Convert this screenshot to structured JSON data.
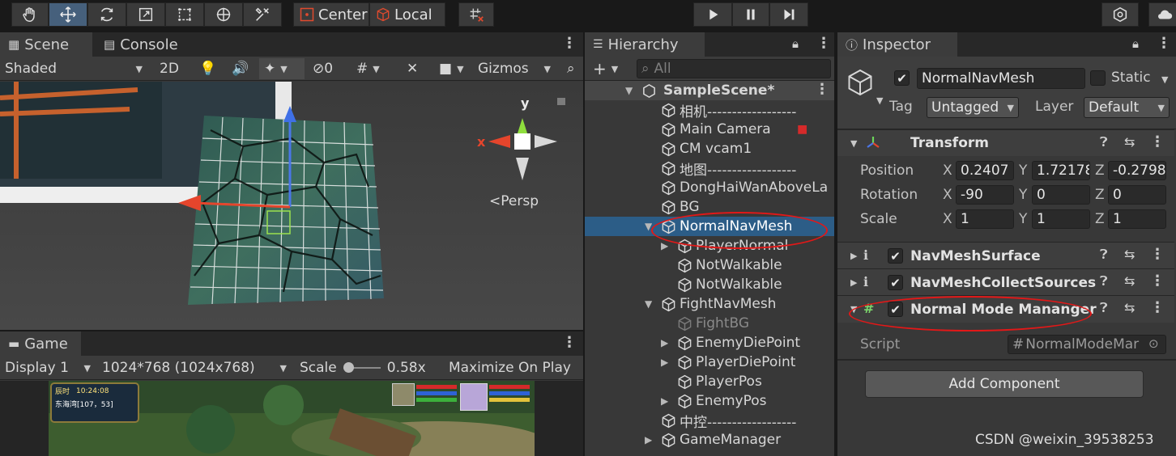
{
  "toolbar": {
    "tools": [
      "hand-tool",
      "move-tool",
      "rotate-tool",
      "scale-tool",
      "rect-tool",
      "transform-tool",
      "custom-tool"
    ],
    "pivot_label": "Center",
    "space_label": "Local"
  },
  "scene": {
    "tabs": {
      "scene": "Scene",
      "console": "Console"
    },
    "shading": "Shaded",
    "mode_2d": "2D",
    "hidden_count": "0",
    "gizmos": "Gizmos",
    "projection": "Persp",
    "axis_x": "x",
    "axis_y": "y"
  },
  "game": {
    "tab": "Game",
    "display": "Display 1",
    "resolution": "1024*768 (1024x768)",
    "scale_label": "Scale",
    "scale_value": "0.58x",
    "maximize": "Maximize On Play",
    "hud_clock": "10:24:08",
    "hud_location": "东海湾[107，53]",
    "hud_time_label": "辰时"
  },
  "hierarchy": {
    "tab": "Hierarchy",
    "search_placeholder": "All",
    "scene_name": "SampleScene*",
    "items": [
      {
        "name": "相机------------------"
      },
      {
        "name": "Main Camera"
      },
      {
        "name": "CM vcam1"
      },
      {
        "name": "地图------------------"
      },
      {
        "name": "DongHaiWanAboveLa"
      },
      {
        "name": "BG"
      },
      {
        "name": "NormalNavMesh"
      },
      {
        "name": "PlayerNormal"
      },
      {
        "name": "NotWalkable"
      },
      {
        "name": "NotWalkable"
      },
      {
        "name": "FightNavMesh"
      },
      {
        "name": "FightBG"
      },
      {
        "name": "EnemyDiePoint"
      },
      {
        "name": "PlayerDiePoint"
      },
      {
        "name": "PlayerPos"
      },
      {
        "name": "EnemyPos"
      },
      {
        "name": "中控------------------"
      },
      {
        "name": "GameManager"
      }
    ]
  },
  "inspector": {
    "tab": "Inspector",
    "object_name": "NormalNavMesh",
    "static_label": "Static",
    "tag_label": "Tag",
    "tag_value": "Untagged",
    "layer_label": "Layer",
    "layer_value": "Default",
    "transform": {
      "title": "Transform",
      "position_label": "Position",
      "rotation_label": "Rotation",
      "scale_label": "Scale",
      "position": {
        "x": "0.2407",
        "y": "1.72178",
        "z": "-0.2798"
      },
      "rotation": {
        "x": "-90",
        "y": "0",
        "z": "0"
      },
      "scale": {
        "x": "1",
        "y": "1",
        "z": "1"
      }
    },
    "components": [
      {
        "title": "NavMeshSurface"
      },
      {
        "title": "NavMeshCollectSources"
      },
      {
        "title": "Normal Mode Mananger"
      }
    ],
    "script_label": "Script",
    "script_value": "NormalModeMar",
    "add_component": "Add Component"
  },
  "watermark": "CSDN @weixin_39538253",
  "axis_letters": {
    "x": "X",
    "y": "Y",
    "z": "Z"
  },
  "colors": {
    "selection": "#2c5d87",
    "active_tool": "#46607c",
    "annotation_red": "#e21818"
  }
}
